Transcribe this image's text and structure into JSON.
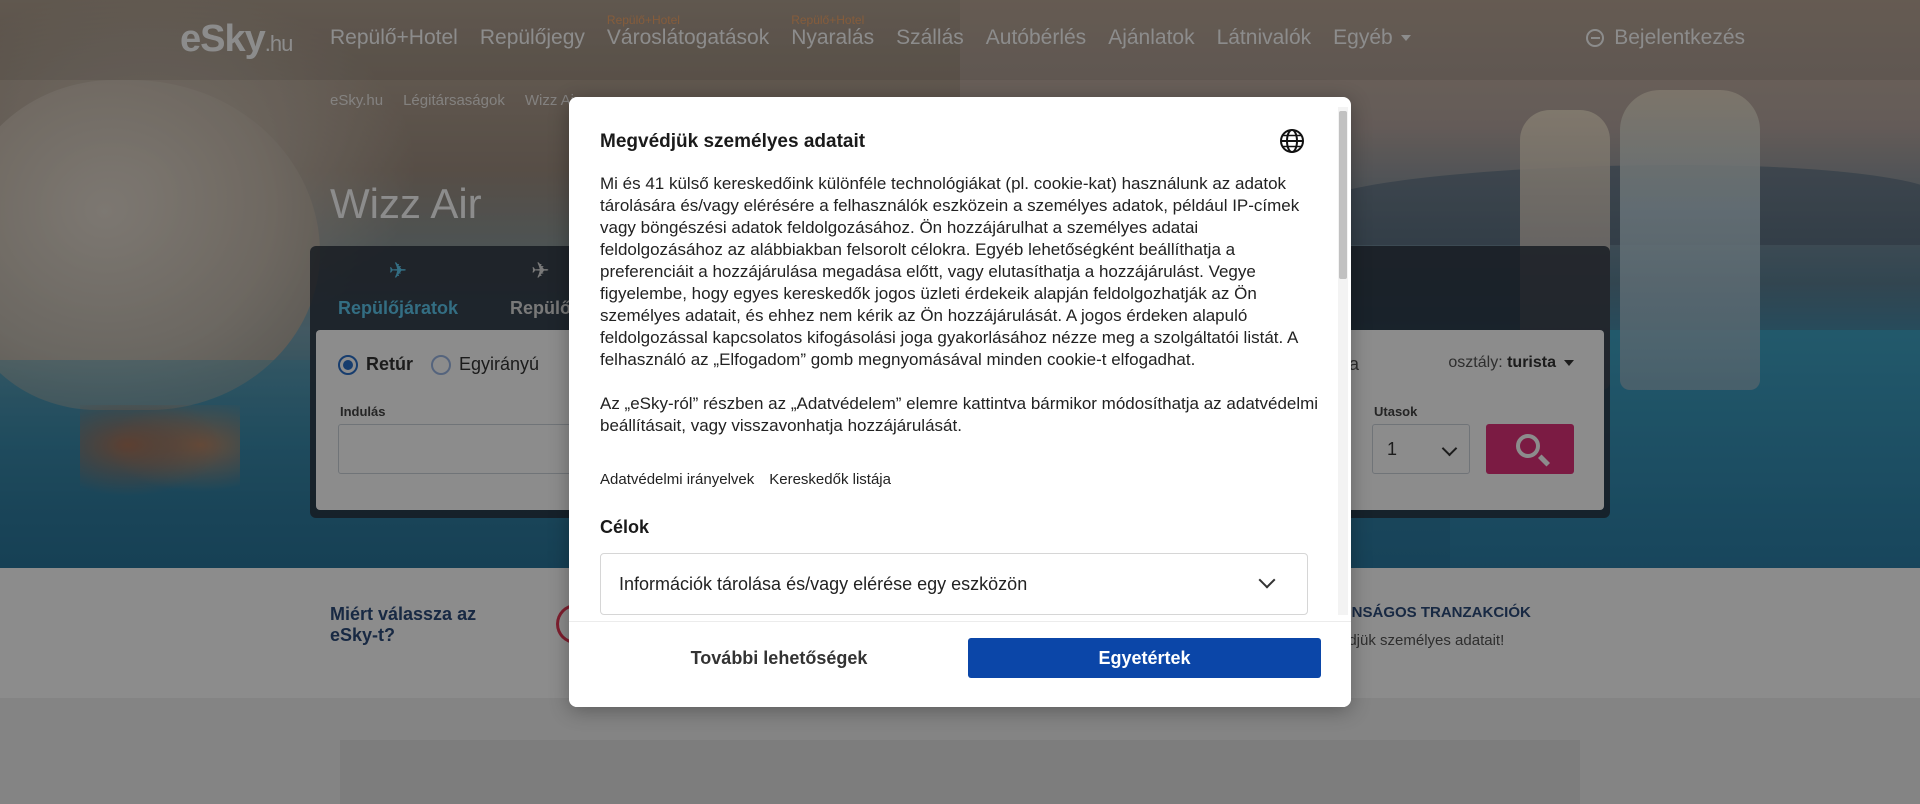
{
  "brand": {
    "logo": "eSky",
    "logo_tld": ".hu"
  },
  "nav": {
    "items": [
      {
        "label": "Repülő+Hotel",
        "tag": ""
      },
      {
        "label": "Repülőjegy",
        "tag": ""
      },
      {
        "label": "Városlátogatások",
        "tag": "Repülő+Hotel"
      },
      {
        "label": "Nyaralás",
        "tag": "Repülő+Hotel"
      },
      {
        "label": "Szállás",
        "tag": ""
      },
      {
        "label": "Autóbérlés",
        "tag": ""
      },
      {
        "label": "Ajánlatok",
        "tag": ""
      },
      {
        "label": "Látnivalók",
        "tag": ""
      },
      {
        "label": "Egyéb",
        "tag": ""
      }
    ],
    "login": "Bejelentkezés"
  },
  "breadcrumb": [
    "eSky.hu",
    "Légitársaságok",
    "Wizz Air"
  ],
  "page_title": "Wizz Air",
  "search": {
    "tabs": [
      "Repülőjáratok",
      "Repülő"
    ],
    "trip_types": [
      "Retúr",
      "Egyirányú"
    ],
    "departure_label": "Indulás",
    "passengers_label": "Utasok",
    "passengers_value": "1",
    "class_prefix": "osztály:",
    "class_value": "turista",
    "partial_text": "ása"
  },
  "benefits": {
    "why_title": "Miért válassza az eSky-t?",
    "secure_title": "ONSÁGOS TRANZAKCIÓK",
    "secure_sub": "édjük személyes adatait!"
  },
  "modal": {
    "title": "Megvédjük személyes adatait",
    "paragraph1": "Mi és 41 külső kereskedőink különféle technológiákat (pl. cookie-kat) használunk az adatok tárolására és/vagy elérésére a felhasználók eszközein a személyes adatok, például IP-címek vagy böngészési adatok feldolgozásához. Ön hozzájárulhat a személyes adatai feldolgozásához az alábbiakban felsorolt célokra. Egyéb lehetőségként beállíthatja a preferenciáit a hozzájárulása megadása előtt, vagy elutasíthatja a hozzájárulást. Vegye figyelembe, hogy egyes kereskedők jogos üzleti érdekeik alapján feldolgozhatják az Ön személyes adatait, és ehhez nem kérik az Ön hozzájárulását. A jogos érdeken alapuló feldolgozással kapcsolatos kifogásolási joga gyakorlásához nézze meg a szolgáltatói listát. A felhasználó az „Elfogadom” gomb megnyomásával minden cookie-t elfogadhat.",
    "paragraph2": "Az „eSky-ról” részben az „Adatvédelem” elemre kattintva bármikor módosíthatja az adatvédelmi beállításait, vagy visszavonhatja hozzájárulását.",
    "link_privacy": "Adatvédelmi irányelvek",
    "link_vendors": "Kereskedők listája",
    "purposes_title": "Célok",
    "purpose_item": "Információk tárolása és/vagy elérése egy eszközön",
    "btn_more": "További lehetőségek",
    "btn_agree": "Egyetértek"
  }
}
